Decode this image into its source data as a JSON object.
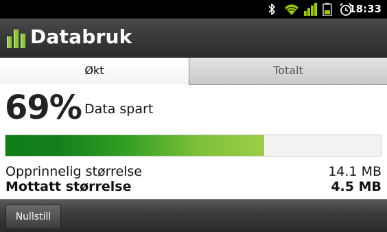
{
  "status_bar": {
    "time": "18:33",
    "icons": [
      "bluetooth-icon",
      "wifi-icon",
      "signal-icon",
      "battery-icon",
      "alarm-icon"
    ],
    "wifi_color": "#9ccc00",
    "signal_color": "#9ccc00",
    "battery_color": "#9ccc00"
  },
  "app": {
    "title": "Databruk",
    "icon": "bar-chart-icon"
  },
  "tabs": [
    {
      "label": "Økt",
      "active": true
    },
    {
      "label": "Totalt",
      "active": false
    }
  ],
  "summary": {
    "percent": "69%",
    "label": "Data spart",
    "progress": 0.69
  },
  "stats": [
    {
      "label": "Opprinnelig størrelse",
      "value": "14.1 MB"
    },
    {
      "label": "Mottatt størrelse",
      "value": "4.5 MB"
    }
  ],
  "footer": {
    "reset_label": "Nullstill"
  }
}
